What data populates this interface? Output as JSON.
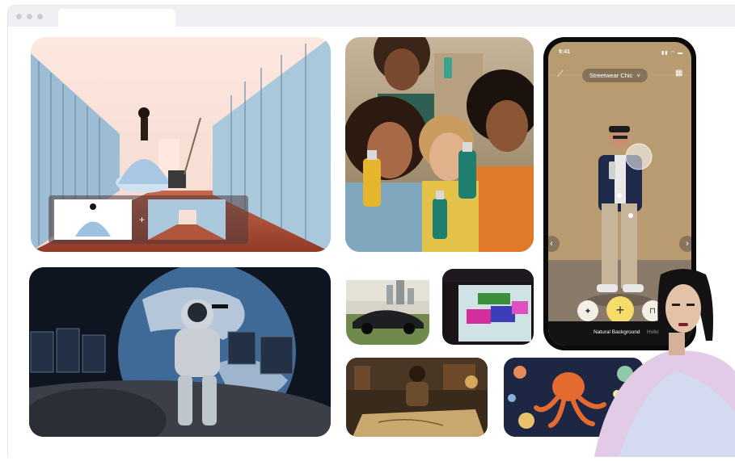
{
  "phone": {
    "time": "9:41",
    "filter_label": "Streetwear Chic",
    "filter_chevron": "˅",
    "bottom_tabs": [
      "Natural Background",
      "Holiday"
    ],
    "icons": [
      "magic-wand-icon",
      "qr-grid-icon",
      "chevron-left-icon",
      "chevron-right-icon",
      "sparkle-icon",
      "plus-icon",
      "bookmark-icon"
    ],
    "add_symbol": "+"
  },
  "merge_symbol": "+",
  "colors": {
    "window_bar": "#eef0f3",
    "accent_yellow": "#f6dd6a",
    "locker_blue": "#a9c8dc",
    "bottle_teal": "#1f7f6e"
  }
}
